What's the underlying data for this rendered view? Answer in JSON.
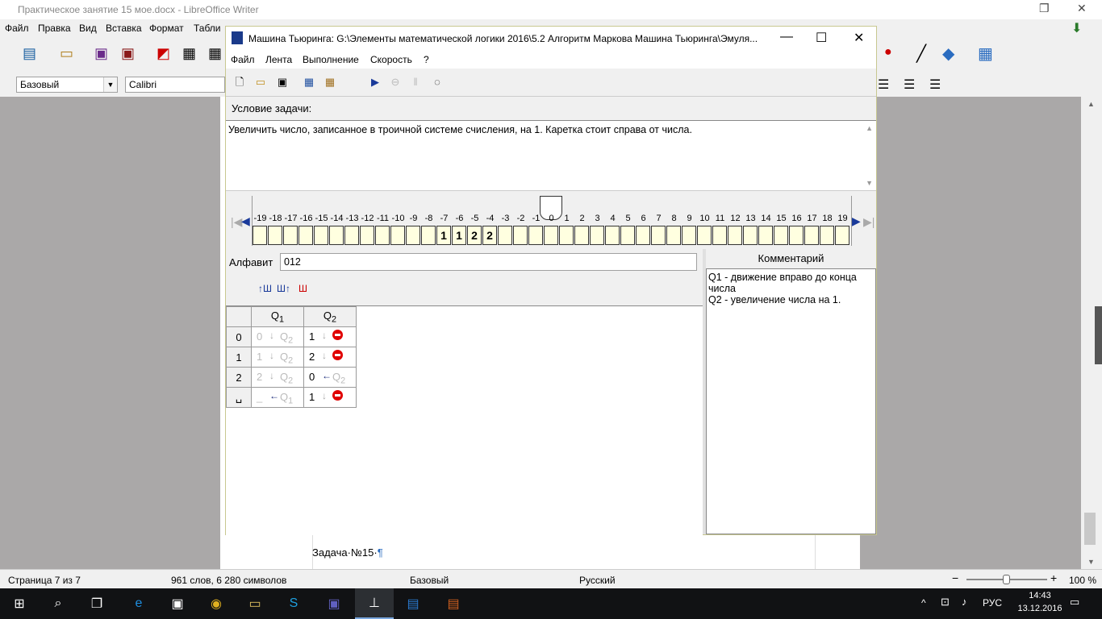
{
  "lo": {
    "title": "Практическое занятие 15 мое.docx - LibreOffice Writer",
    "menu": [
      "Файл",
      "Правка",
      "Вид",
      "Вставка",
      "Формат",
      "Табли"
    ],
    "style_combo": "Базовый",
    "font_combo": "Calibri",
    "doc_text": "Задача·№15·",
    "pilcrow": "¶",
    "status": {
      "page": "Страница 7 из 7",
      "words": "961 слов, 6 280 символов",
      "style": "Базовый",
      "lang": "Русский",
      "zoom": "100 %"
    }
  },
  "taskbar": {
    "lang": "РУС",
    "time": "14:43",
    "date": "13.12.2016"
  },
  "turing": {
    "title": "Машина Тьюринга: G:\\Элементы математической логики 2016\\5.2 Алгоритм Маркова Машина Тьюринга\\Эмуля...",
    "menu": [
      "Файл",
      "Лента",
      "Выполнение",
      "Скорость",
      "?"
    ],
    "cond_label": "Условие задачи:",
    "condition": "Увеличить число, записанное в троичной системе счисления, на 1. Каретка стоит справа от числа.",
    "alphabet_label": "Алфавит",
    "alphabet": "012",
    "comment_label": "Комментарий",
    "comments": [
      "Q1 - движение вправо до конца числа",
      "Q2 - увеличение числа на 1."
    ],
    "tape": {
      "indices": [
        "-19",
        "-18",
        "-17",
        "-16",
        "-15",
        "-14",
        "-13",
        "-12",
        "-11",
        "-10",
        "-9",
        "-8",
        "-7",
        "-6",
        "-5",
        "-4",
        "-3",
        "-2",
        "-1",
        "0",
        "1",
        "2",
        "3",
        "4",
        "5",
        "6",
        "7",
        "8",
        "9",
        "10",
        "11",
        "12",
        "13",
        "14",
        "15",
        "16",
        "17",
        "18",
        "19"
      ],
      "cells": [
        "",
        "",
        "",
        "",
        "",
        "",
        "",
        "",
        "",
        "",
        "",
        "",
        "1",
        "1",
        "2",
        "2",
        "",
        "",
        "",
        "",
        "",
        "",
        "",
        "",
        "",
        "",
        "",
        "",
        "",
        "",
        "",
        "",
        "",
        "",
        "",
        "",
        "",
        "",
        ""
      ],
      "head_index": "0"
    },
    "table": {
      "states": [
        "Q1",
        "Q2"
      ],
      "rows": [
        {
          "sym": "0",
          "q1": {
            "v": "0",
            "m": "down",
            "s": "Q2",
            "faded": true
          },
          "q2": {
            "v": "1",
            "m": "down",
            "s": "stop"
          }
        },
        {
          "sym": "1",
          "q1": {
            "v": "1",
            "m": "down",
            "s": "Q2",
            "faded": true
          },
          "q2": {
            "v": "2",
            "m": "down",
            "s": "stop"
          }
        },
        {
          "sym": "2",
          "q1": {
            "v": "2",
            "m": "down",
            "s": "Q2",
            "faded": true
          },
          "q2": {
            "v": "0",
            "m": "left",
            "s": "Q2",
            "sfaded": true
          }
        },
        {
          "sym": "␣",
          "q1": {
            "v": "_",
            "m": "left",
            "s": "Q1",
            "faded": true
          },
          "q2": {
            "v": "1",
            "m": "down",
            "s": "stop"
          }
        }
      ]
    }
  }
}
